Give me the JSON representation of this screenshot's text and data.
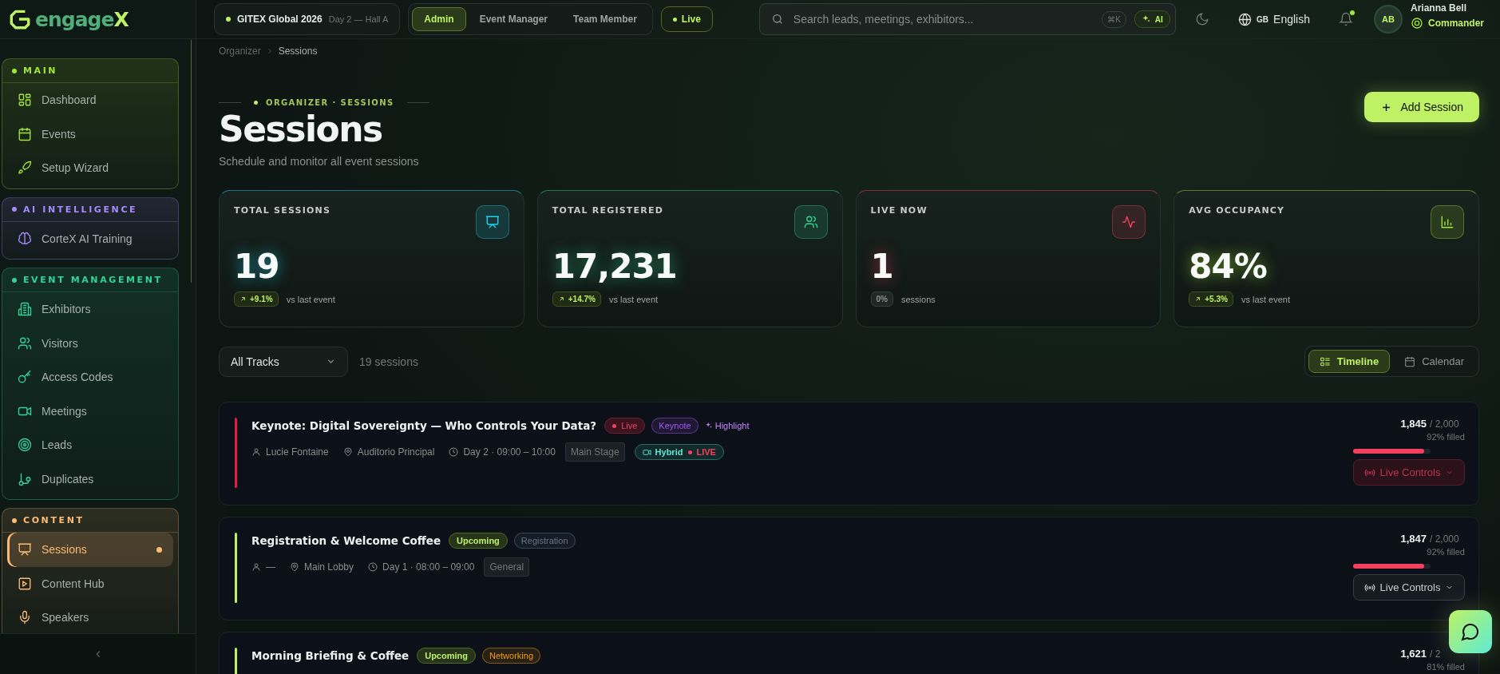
{
  "brand": {
    "name_start": "engage",
    "name_end": "X"
  },
  "topbar": {
    "event": {
      "name": "GITEX Global 2026",
      "detail": "Day 2 — Hall A"
    },
    "roles": [
      {
        "label": "Admin",
        "selected": true
      },
      {
        "label": "Event Manager",
        "selected": false
      },
      {
        "label": "Team Member",
        "selected": false
      }
    ],
    "live_badge": {
      "label": "Live",
      "on": true
    },
    "search": {
      "placeholder": "Search leads, meetings, exhibitors...",
      "shortcut": "⌘K",
      "ai_label": "AI"
    },
    "language": {
      "flag": "GB",
      "label": "English"
    },
    "notifications": {
      "unread": true
    },
    "user": {
      "initials": "AB",
      "name": "Arianna Bell",
      "role": "Commander"
    }
  },
  "sidebar": {
    "sections": [
      {
        "title": "MAIN",
        "color": "#a3e635",
        "items": [
          {
            "label": "Dashboard",
            "selected": false
          },
          {
            "label": "Events",
            "selected": false
          },
          {
            "label": "Setup Wizard",
            "selected": false
          }
        ]
      },
      {
        "title": "AI INTELLIGENCE",
        "color": "#a78bfa",
        "items": [
          {
            "label": "CorteX AI Training",
            "selected": false
          }
        ]
      },
      {
        "title": "EVENT MANAGEMENT",
        "color": "#34d399",
        "items": [
          {
            "label": "Exhibitors",
            "selected": false
          },
          {
            "label": "Visitors",
            "selected": false
          },
          {
            "label": "Access Codes",
            "selected": false
          },
          {
            "label": "Meetings",
            "selected": false
          },
          {
            "label": "Leads",
            "selected": false
          },
          {
            "label": "Duplicates",
            "selected": false
          }
        ]
      },
      {
        "title": "CONTENT",
        "color": "#fdba74",
        "items": [
          {
            "label": "Sessions",
            "selected": true
          },
          {
            "label": "Content Hub",
            "selected": false
          },
          {
            "label": "Speakers",
            "selected": false
          }
        ]
      }
    ]
  },
  "breadcrumb": [
    "Organizer",
    "Sessions"
  ],
  "header": {
    "eyebrow": "ORGANIZER · SESSIONS",
    "title": "Sessions",
    "subtitle": "Schedule and monitor all event sessions",
    "add_button": "Add Session"
  },
  "stats": [
    {
      "label": "TOTAL SESSIONS",
      "value": "19",
      "delta": "+9.1%",
      "rising": true,
      "note": "vs last event",
      "color": "#22d3ee"
    },
    {
      "label": "TOTAL REGISTERED",
      "value": "17,231",
      "delta": "+14.7%",
      "rising": true,
      "note": "vs last event",
      "color": "#34d399"
    },
    {
      "label": "LIVE NOW",
      "value": "1",
      "delta": "0%",
      "rising": false,
      "note": "sessions",
      "color": "#f43f5e"
    },
    {
      "label": "AVG OCCUPANCY",
      "value": "84%",
      "delta": "+5.3%",
      "rising": true,
      "note": "vs last event",
      "color": "#a3e635"
    }
  ],
  "filter": {
    "track": "All Tracks",
    "count": "19 sessions"
  },
  "views": [
    {
      "label": "Timeline",
      "selected": true
    },
    {
      "label": "Calendar",
      "selected": false
    }
  ],
  "sessions": [
    {
      "title": "Keynote: Digital Sovereignty — Who Controls Your Data?",
      "status": "Live",
      "live": true,
      "color": "#e11d48",
      "tags": [
        {
          "label": "Keynote",
          "kind": "tag",
          "color": "#a855f7"
        },
        {
          "label": "Highlight",
          "kind": "highlight",
          "color": "#c084fc"
        }
      ],
      "meta": {
        "speaker": "Lucie Fontaine",
        "location": "Auditorio Principal",
        "time": "Day 2 · 09:00 – 10:00",
        "track": "Main Stage",
        "hybrid": {
          "label": "Hybrid",
          "live_label": "LIVE"
        }
      },
      "count": "1,845",
      "capacity": "/ 2,000",
      "filled": "92% filled",
      "level": 0.92,
      "controls": "Live Controls"
    },
    {
      "title": "Registration & Welcome Coffee",
      "status": "Upcoming",
      "live": false,
      "color": "#bef264",
      "tags": [
        {
          "label": "Registration",
          "kind": "tag",
          "color": "#64748b"
        }
      ],
      "meta": {
        "speaker": "—",
        "location": "Main Lobby",
        "time": "Day 1 · 08:00 – 09:00",
        "track": "General"
      },
      "count": "1,847",
      "capacity": "/ 2,000",
      "filled": "92% filled",
      "level": 0.92,
      "controls": "Live Controls"
    },
    {
      "title": "Morning Briefing & Coffee",
      "status": "Upcoming",
      "live": false,
      "color": "#bef264",
      "tags": [
        {
          "label": "Networking",
          "kind": "tag",
          "color": "#f59e0b"
        }
      ],
      "count": "1,621",
      "capacity": "/ 2",
      "filled": "81% filled"
    }
  ]
}
